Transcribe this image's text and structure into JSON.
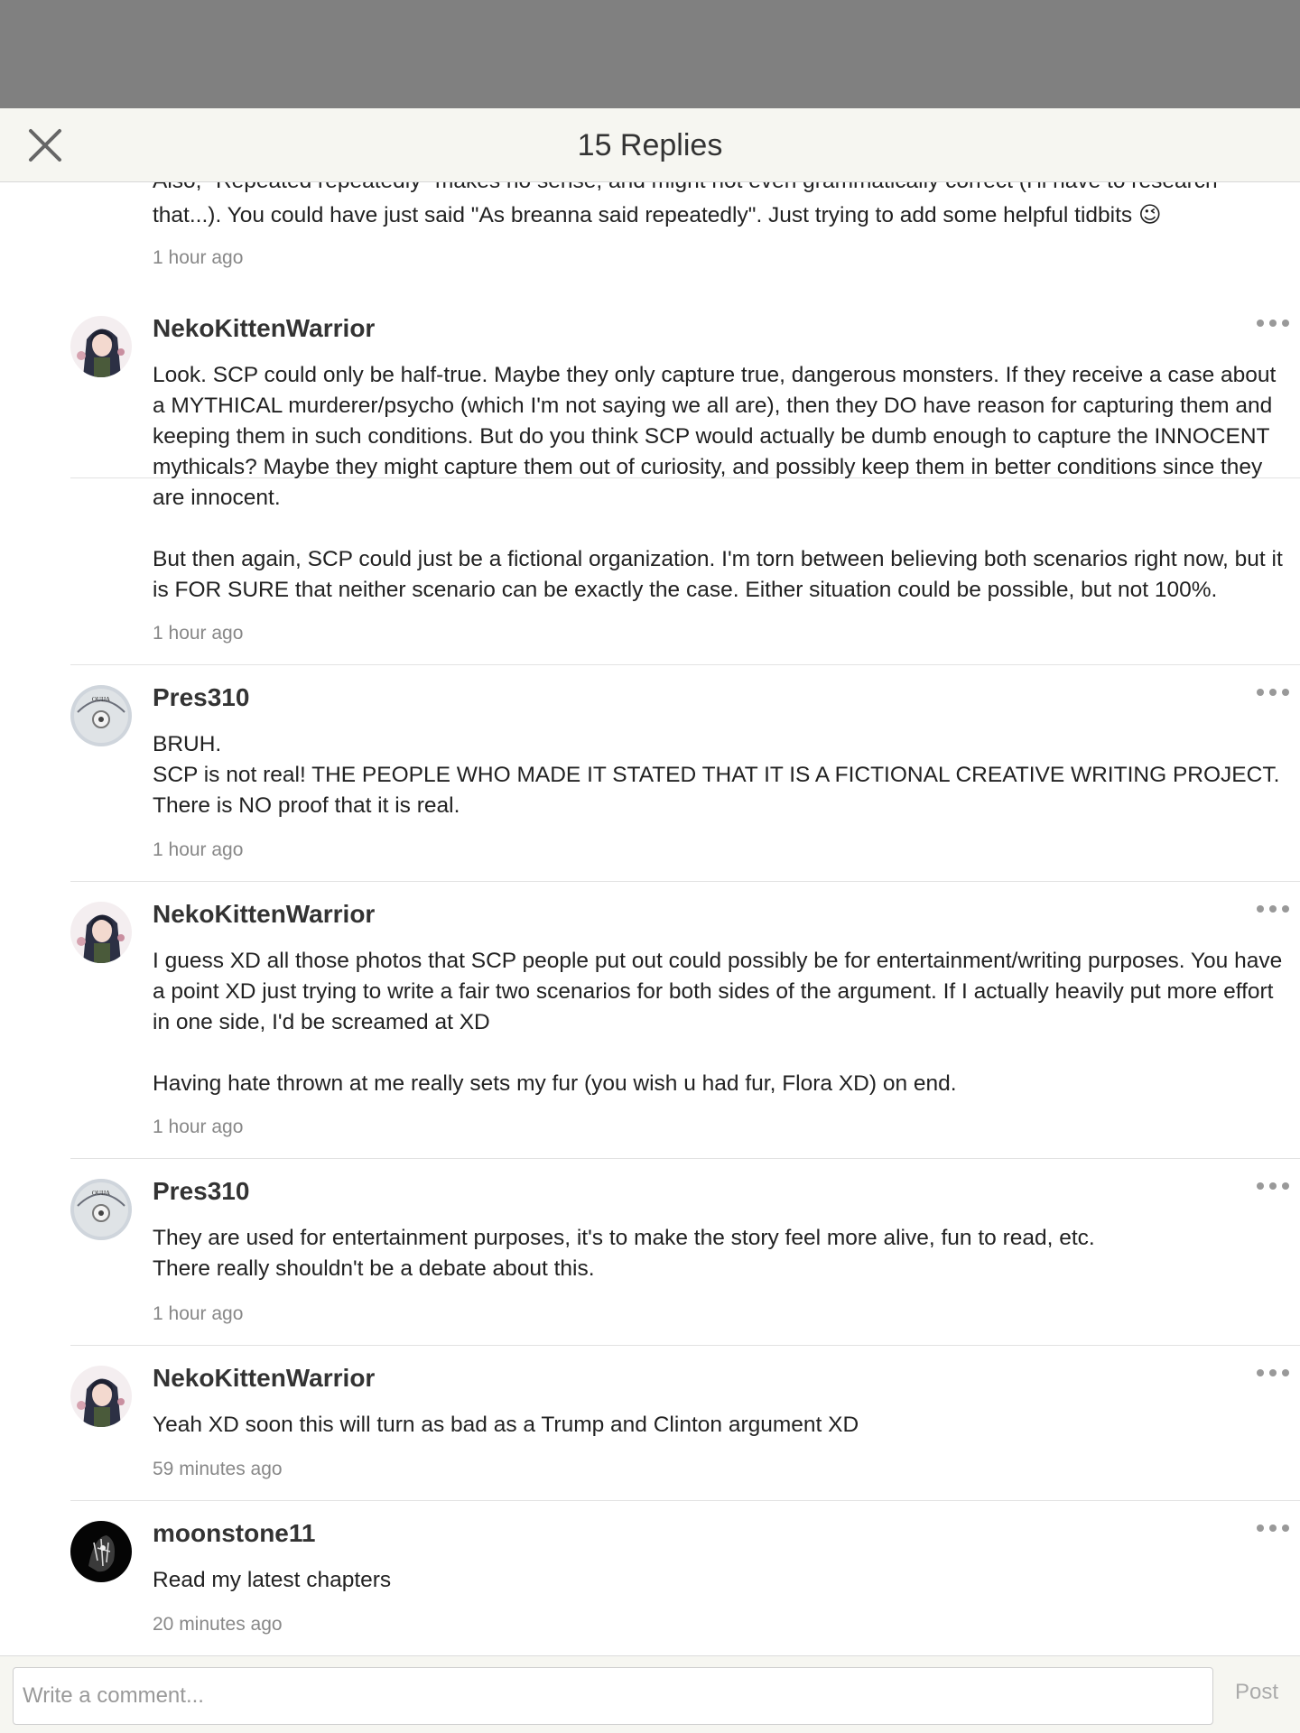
{
  "header": {
    "title": "15 Replies"
  },
  "replies": [
    {
      "text_clipped": "Also, \"Repeated repeatedly\" makes no sense, and might not even grammatically correct (I'll have to research",
      "text": "that...). You could have just said \"As breanna said repeatedly\". Just trying to add some helpful tidbits 😉",
      "time": "1 hour ago"
    },
    {
      "user": "NekoKittenWarrior",
      "text": "Look. SCP could only be half-true. Maybe they only capture true, dangerous monsters. If they receive a case about a MYTHICAL murderer/psycho (which I'm not saying we all are), then they DO have reason for capturing them and keeping them in such conditions. But do you think SCP would actually be dumb enough to capture the INNOCENT mythicals? Maybe they might capture them out of curiosity, and possibly keep them in better conditions since they are innocent.\n\nBut then again, SCP could just be a fictional organization. I'm torn between believing both scenarios right now, but it is FOR SURE that neither scenario can be exactly the case. Either situation could be possible, but not 100%.",
      "time": "1 hour ago"
    },
    {
      "user": "Pres310",
      "text": "BRUH.\nSCP is not real! THE PEOPLE WHO MADE IT STATED THAT IT IS A FICTIONAL CREATIVE WRITING PROJECT. There is NO proof that it is real.",
      "time": "1 hour ago"
    },
    {
      "user": "NekoKittenWarrior",
      "text": "I guess XD all those photos that SCP people put out could possibly be for entertainment/writing purposes. You have a point XD just trying to write a fair two scenarios for both sides of the argument. If I actually heavily put more effort in one side, I'd be screamed at XD\n\nHaving hate thrown at me really sets my fur (you wish u had fur, Flora XD) on end.",
      "time": "1 hour ago"
    },
    {
      "user": "Pres310",
      "text": "They are used for entertainment purposes, it's to make the story feel more alive, fun to read, etc.\nThere really shouldn't be a debate about this.",
      "time": "1 hour ago"
    },
    {
      "user": "NekoKittenWarrior",
      "text": "Yeah XD soon this will turn as bad as a Trump and Clinton argument XD",
      "time": "59 minutes ago"
    },
    {
      "user": "moonstone11",
      "text": "Read my latest chapters",
      "time": "20 minutes ago"
    }
  ],
  "avatar_labels": {
    "pres310": "OUIJA"
  },
  "composer": {
    "placeholder": "Write a comment...",
    "post_label": "Post"
  },
  "colors": {
    "header_bg": "#f6f6f1",
    "overlay": "#808080",
    "timestamp": "#888888"
  }
}
